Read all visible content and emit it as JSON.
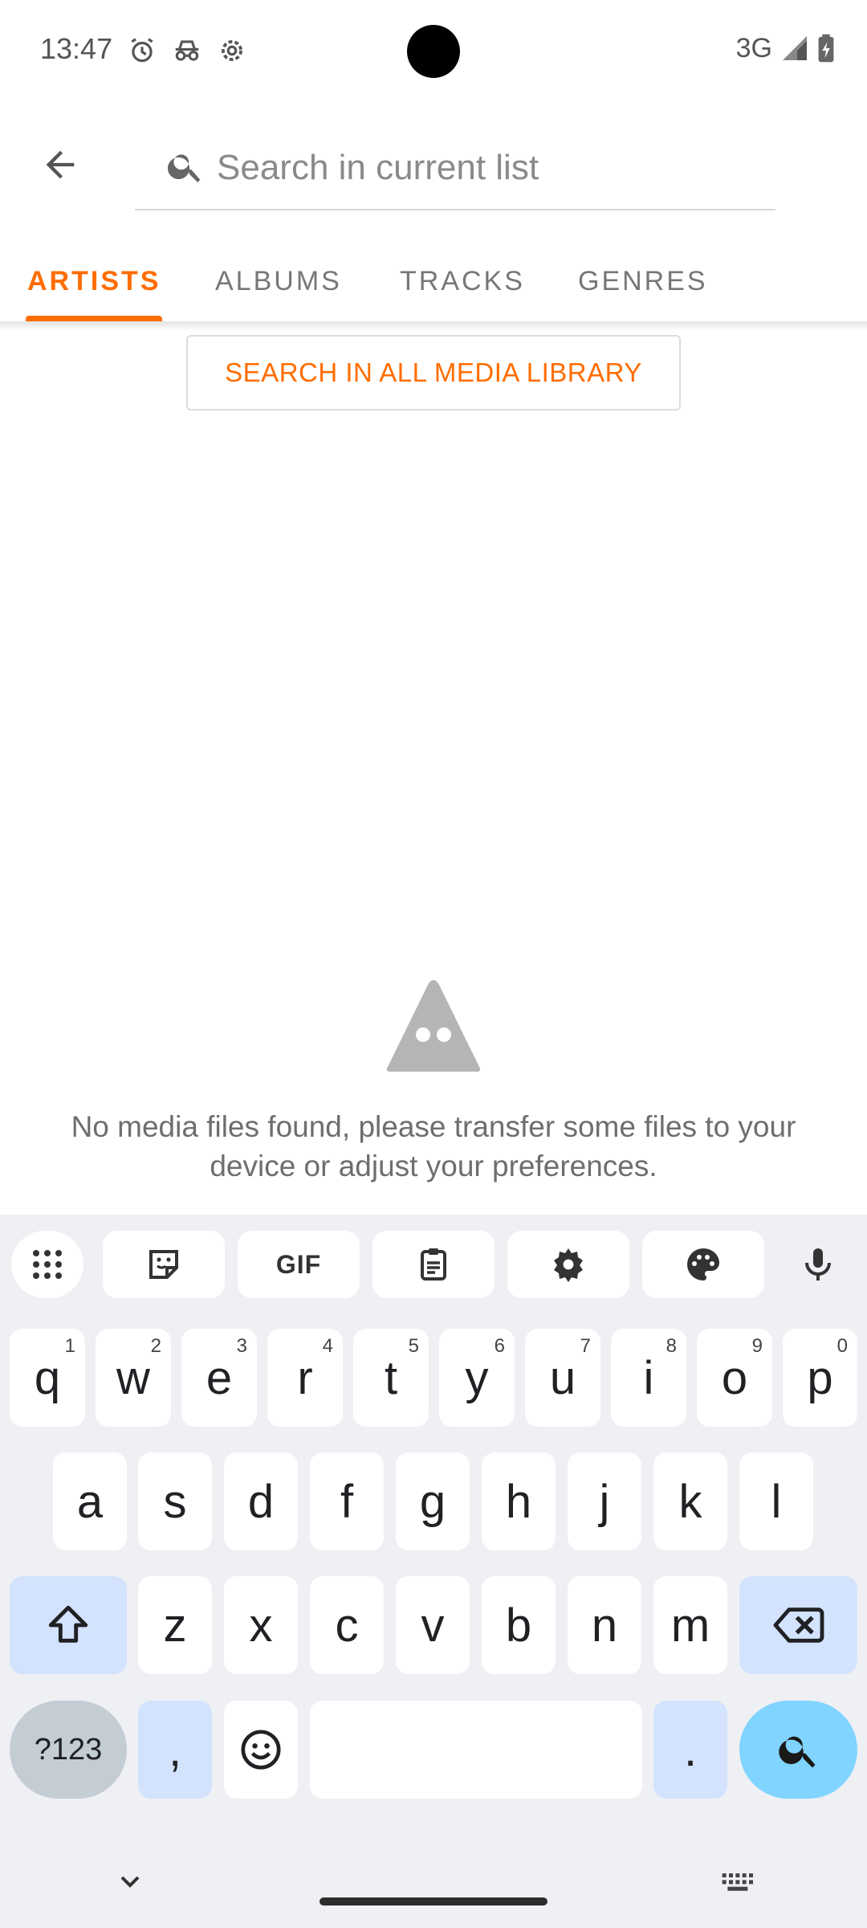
{
  "status_bar": {
    "time": "13:47",
    "network": "3G",
    "icons": [
      "alarm-icon",
      "incognito-icon",
      "settings-gear-icon",
      "signal-icon",
      "battery-charging-icon"
    ]
  },
  "search": {
    "placeholder": "Search in current list",
    "value": ""
  },
  "tabs": [
    {
      "label": "ARTISTS",
      "active": true
    },
    {
      "label": "ALBUMS",
      "active": false
    },
    {
      "label": "TRACKS",
      "active": false
    },
    {
      "label": "GENRES",
      "active": false
    }
  ],
  "search_all_button": "SEARCH IN ALL MEDIA LIBRARY",
  "empty_state": {
    "icon": "vlc-ghost-icon",
    "message": "No media files found, please transfer some files to your device or adjust your preferences."
  },
  "colors": {
    "accent": "#ff6d00",
    "keyboard_bg": "#eef0f4",
    "modifier_key": "#d3e3fd",
    "search_key": "#80d4ff"
  },
  "keyboard": {
    "toolbar": [
      "apps-grid-icon",
      "sticker-icon",
      "gif-icon",
      "clipboard-icon",
      "settings-icon",
      "palette-icon",
      "microphone-icon"
    ],
    "gif_label": "GIF",
    "row1": [
      {
        "key": "q",
        "hint": "1"
      },
      {
        "key": "w",
        "hint": "2"
      },
      {
        "key": "e",
        "hint": "3"
      },
      {
        "key": "r",
        "hint": "4"
      },
      {
        "key": "t",
        "hint": "5"
      },
      {
        "key": "y",
        "hint": "6"
      },
      {
        "key": "u",
        "hint": "7"
      },
      {
        "key": "i",
        "hint": "8"
      },
      {
        "key": "o",
        "hint": "9"
      },
      {
        "key": "p",
        "hint": "0"
      }
    ],
    "row2": [
      "a",
      "s",
      "d",
      "f",
      "g",
      "h",
      "j",
      "k",
      "l"
    ],
    "row3": [
      "z",
      "x",
      "c",
      "v",
      "b",
      "n",
      "m"
    ],
    "symbols_key": "?123",
    "comma_key": ",",
    "period_key": "."
  }
}
